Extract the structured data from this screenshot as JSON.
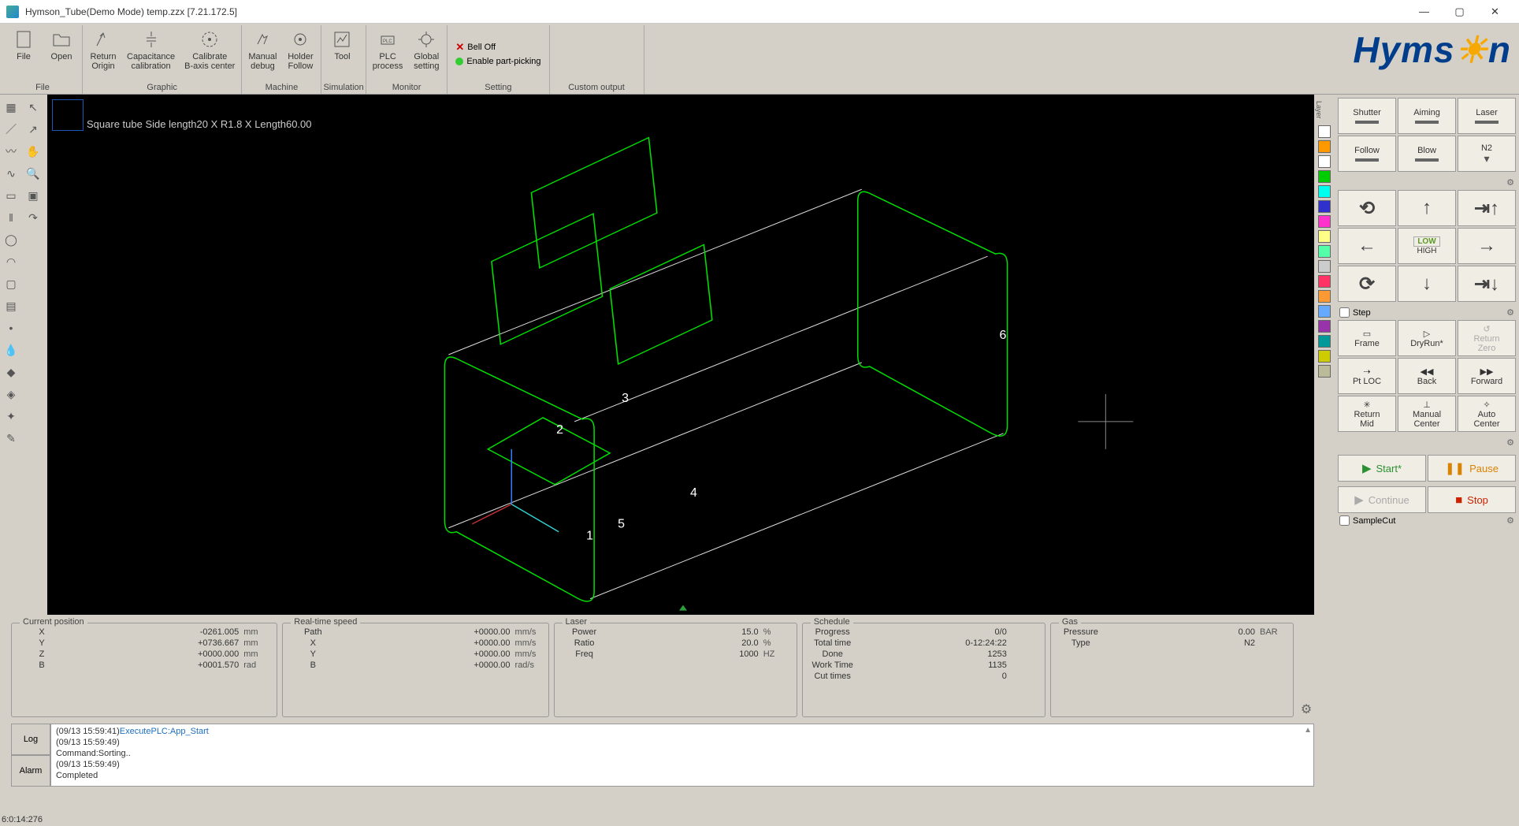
{
  "window": {
    "title": "Hymson_Tube(Demo Mode) temp.zzx  [7.21.172.5]"
  },
  "ribbon": {
    "file": {
      "caption": "File",
      "file_btn": "File",
      "open_btn": "Open"
    },
    "graphic": {
      "caption": "Graphic",
      "return_origin": "Return\nOrigin",
      "capacitance": "Capacitance\ncalibration",
      "calibrate": "Calibrate\nB-axis center"
    },
    "machine": {
      "caption": "Machine",
      "manual": "Manual\ndebug",
      "holder": "Holder\nFollow"
    },
    "simulation": {
      "caption": "Simulation",
      "tool": "Tool"
    },
    "monitor": {
      "caption": "Monitor",
      "plc": "PLC\nprocess",
      "global": "Global\nsetting"
    },
    "setting": {
      "caption": "Setting",
      "bell": "Bell Off",
      "partpick": "Enable part-picking"
    },
    "custom": {
      "caption": "Custom output"
    }
  },
  "brand": "Hymson",
  "viewport_label": "Square tube Side length20 X R1.8 X Length60.00",
  "layer_heading": "Layer",
  "layer_colors": [
    "#ffffff",
    "#ff9900",
    "#ffffff",
    "#00cc00",
    "#00ffee",
    "#3030cc",
    "#ff33cc",
    "#ffff88",
    "#55ffaa",
    "#cccccc",
    "#ff3366",
    "#ff9933",
    "#66aaff",
    "#9933aa",
    "#009999",
    "#cccc00",
    "#bbbb99"
  ],
  "rpanel": {
    "row1": [
      "Shutter",
      "Aiming",
      "Laser"
    ],
    "row2": [
      "Follow",
      "Blow",
      "N2"
    ],
    "lowhigh": {
      "low": "LOW",
      "high": "HIGH"
    },
    "step_label": "Step",
    "grid2": {
      "frame": "Frame",
      "dryrun": "DryRun*",
      "retzero": "Return\nZero",
      "ptloc": "Pt LOC",
      "back": "Back",
      "forward": "Forward",
      "retmid": "Return\nMid",
      "mancenter": "Manual\nCenter",
      "autocenter": "Auto\nCenter"
    },
    "start": "Start*",
    "pause": "Pause",
    "continue": "Continue",
    "stop": "Stop",
    "samplecut": "SampleCut"
  },
  "status": {
    "pos": {
      "title": "Current position",
      "rows": [
        {
          "k": "X",
          "v": "-0261.005",
          "u": "mm"
        },
        {
          "k": "Y",
          "v": "+0736.667",
          "u": "mm"
        },
        {
          "k": "Z",
          "v": "+0000.000",
          "u": "mm"
        },
        {
          "k": "B",
          "v": "+0001.570",
          "u": "rad"
        }
      ]
    },
    "speed": {
      "title": "Real-time speed",
      "rows": [
        {
          "k": "Path",
          "v": "+0000.00",
          "u": "mm/s"
        },
        {
          "k": "X",
          "v": "+0000.00",
          "u": "mm/s"
        },
        {
          "k": "Y",
          "v": "+0000.00",
          "u": "mm/s"
        },
        {
          "k": "B",
          "v": "+0000.00",
          "u": "rad/s"
        }
      ]
    },
    "laser": {
      "title": "Laser",
      "rows": [
        {
          "k": "Power",
          "v": "15.0",
          "u": "%"
        },
        {
          "k": "Ratio",
          "v": "20.0",
          "u": "%"
        },
        {
          "k": "Freq",
          "v": "1000",
          "u": "HZ"
        }
      ]
    },
    "schedule": {
      "title": "Schedule",
      "rows": [
        {
          "k": "Progress",
          "v": "0/0",
          "u": ""
        },
        {
          "k": "Total time",
          "v": "0-12:24:22",
          "u": ""
        },
        {
          "k": "Done",
          "v": "1253",
          "u": ""
        },
        {
          "k": "Work Time",
          "v": "1135",
          "u": ""
        },
        {
          "k": "Cut times",
          "v": "0",
          "u": ""
        }
      ]
    },
    "gas": {
      "title": "Gas",
      "rows": [
        {
          "k": "Pressure",
          "v": "0.00",
          "u": "BAR"
        },
        {
          "k": "Type",
          "v": "N2",
          "u": ""
        }
      ]
    }
  },
  "log": {
    "tabs": [
      "Log",
      "Alarm"
    ],
    "lines": [
      {
        "t": "(09/13 15:59:41)",
        "c": "ExecutePLC:App_Start",
        "cmd": true
      },
      {
        "t": "(09/13 15:59:49)",
        "c": "",
        "cmd": false
      },
      {
        "t": "",
        "c": "Command:Sorting..",
        "cmd": false
      },
      {
        "t": "(09/13 15:59:49)",
        "c": "",
        "cmd": false
      },
      {
        "t": "",
        "c": "Completed",
        "cmd": false
      }
    ]
  },
  "footer": "6:0:14:276"
}
